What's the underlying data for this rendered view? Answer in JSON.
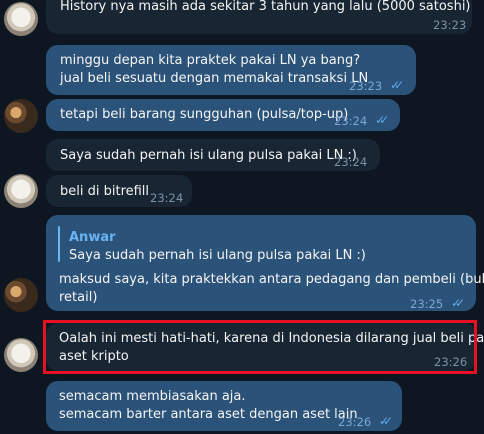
{
  "messages": [
    {
      "text": "History nya masih ada sekitar 3 tahun yang lalu (5000 satoshi)",
      "time": "23:23"
    },
    {
      "lines": [
        "minggu depan kita praktek pakai LN ya bang?",
        "jual beli sesuatu dengan memakai transaksi LN"
      ],
      "time": "23:23"
    },
    {
      "text": "tetapi beli barang sungguhan (pulsa/top-up)",
      "time": "23:24"
    },
    {
      "text": "Saya sudah pernah isi ulang pulsa pakai LN :)",
      "time": "23:24"
    },
    {
      "text": "beli di bitrefill",
      "time": "23:24"
    },
    {
      "quote_name": "Anwar",
      "quote_text": "Saya sudah pernah isi ulang pulsa pakai LN :)",
      "lines": [
        "maksud saya, kita praktekkan antara pedagang dan pembeli (bukan",
        "retail)"
      ],
      "time": "23:25"
    },
    {
      "lines": [
        "Oalah ini mesti hati-hati, karena di Indonesia dilarang jual beli pakai",
        "aset kripto"
      ],
      "time": "23:26"
    },
    {
      "lines": [
        "semacam membiasakan aja.",
        "semacam barter antara aset dengan aset lain"
      ],
      "time": "23:26"
    }
  ],
  "colors": {
    "background": "#0e1621",
    "incoming": "#182533",
    "outgoing": "#2b5278",
    "highlight": "#e81123"
  }
}
